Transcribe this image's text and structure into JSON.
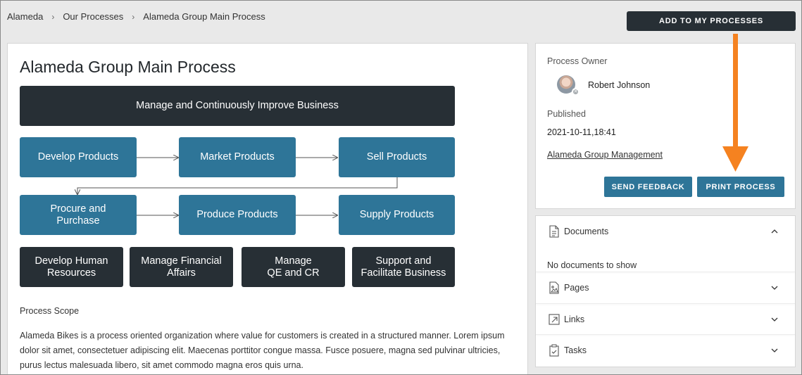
{
  "breadcrumb": [
    "Alameda",
    "Our Processes",
    "Alameda Group Main Process"
  ],
  "header": {
    "add_button": "ADD TO MY PROCESSES"
  },
  "process": {
    "title": "Alameda Group Main Process",
    "diagram": {
      "top": "Manage and Continuously Improve Business",
      "row1": [
        "Develop Products",
        "Market Products",
        "Sell Products"
      ],
      "row2": [
        "Procure and\nPurchase",
        "Produce Products",
        "Supply Products"
      ],
      "row3": [
        "Develop Human\nResources",
        "Manage Financial\nAffairs",
        "Manage\nQE and CR",
        "Support and\nFacilitate Business"
      ]
    },
    "scope_title": "Process Scope",
    "scope_text": "Alameda Bikes is a process oriented organization where value for customers is created in a structured manner. Lorem ipsum dolor sit amet, consectetuer adipiscing elit. Maecenas porttitor congue massa. Fusce posuere, magna sed pulvinar ultricies, purus lectus malesuada libero, sit amet commodo magna eros quis urna."
  },
  "owner_panel": {
    "owner_label": "Process Owner",
    "owner_name": "Robert Johnson",
    "published_label": "Published",
    "published_date": "2021-10-11,18:41",
    "group_link": "Alameda Group Management",
    "feedback_button": "SEND FEEDBACK",
    "print_button": "PRINT PROCESS"
  },
  "accordion": {
    "documents": {
      "label": "Documents",
      "empty": "No documents to show",
      "icon": "document-icon"
    },
    "pages": {
      "label": "Pages",
      "icon": "image-icon"
    },
    "links": {
      "label": "Links",
      "icon": "external-link-icon"
    },
    "tasks": {
      "label": "Tasks",
      "icon": "clipboard-check-icon"
    }
  },
  "colors": {
    "dark": "#272f35",
    "blue": "#2e7598",
    "arrow": "#f58220"
  }
}
